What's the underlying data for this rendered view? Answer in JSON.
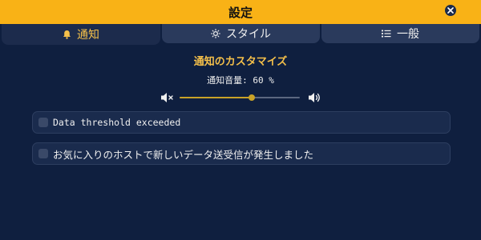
{
  "window": {
    "title": "設定",
    "close_icon": "close-icon"
  },
  "tabs": [
    {
      "label": "通知",
      "icon": "bell-icon",
      "active": true
    },
    {
      "label": "スタイル",
      "icon": "sun-icon",
      "active": false
    },
    {
      "label": "一般",
      "icon": "list-icon",
      "active": false
    }
  ],
  "notifications": {
    "section_title": "通知のカスタマイズ",
    "volume_label": "通知音量: 60 %",
    "volume_value": 60,
    "volume_max": 100,
    "mute_icon": "volume-mute-icon",
    "loud_icon": "volume-high-icon",
    "options": [
      {
        "label": "Data threshold exceeded",
        "checked": false
      },
      {
        "label": "お気に入りのホストで新しいデータ送受信が発生しました",
        "checked": false
      }
    ]
  },
  "colors": {
    "accent": "#f9b216",
    "highlight": "#f5c04a",
    "background": "#0f1f3f",
    "slider_fill": "#c9a227"
  }
}
